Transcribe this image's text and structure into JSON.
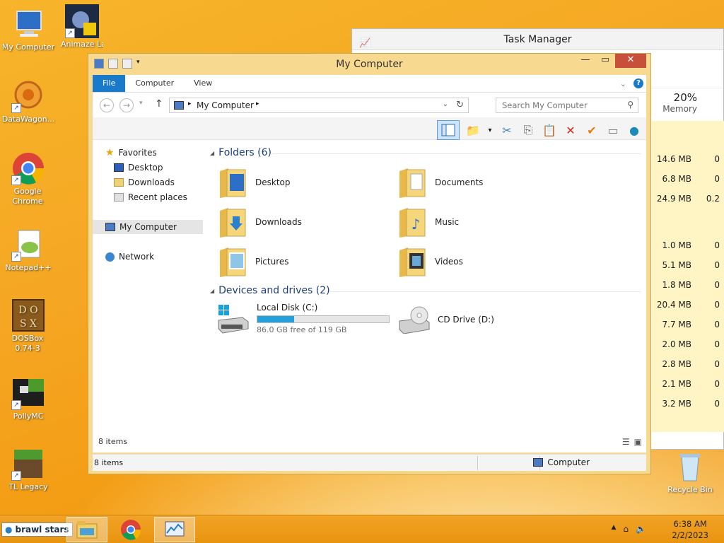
{
  "desktop": {
    "icons": [
      {
        "label": "My Computer"
      },
      {
        "label": "Animaze Launc"
      },
      {
        "label": "DataWagon..."
      },
      {
        "label": "Google Chrome"
      },
      {
        "label": "Notepad++"
      },
      {
        "label": "DOSBox 0.74-3"
      },
      {
        "label": "PollyMC"
      },
      {
        "label": "TL Legacy"
      },
      {
        "label": "Recycle Bin"
      }
    ]
  },
  "task_manager": {
    "title": "Task Manager",
    "memory_percent": "20%",
    "memory_label": "Memory",
    "rows": [
      {
        "mem": "14.6 MB",
        "cpu": "0"
      },
      {
        "mem": "6.8 MB",
        "cpu": "0"
      },
      {
        "mem": "24.9 MB",
        "cpu": "0.2"
      },
      {
        "mem": "1.0 MB",
        "cpu": "0"
      },
      {
        "mem": "5.1 MB",
        "cpu": "0"
      },
      {
        "mem": "1.8 MB",
        "cpu": "0"
      },
      {
        "mem": "20.4 MB",
        "cpu": "0"
      },
      {
        "mem": "7.7 MB",
        "cpu": "0"
      },
      {
        "mem": "2.0 MB",
        "cpu": "0"
      },
      {
        "mem": "2.8 MB",
        "cpu": "0"
      },
      {
        "mem": "2.1 MB",
        "cpu": "0"
      },
      {
        "mem": "3.2 MB",
        "cpu": "0"
      }
    ]
  },
  "explorer": {
    "title": "My Computer",
    "tabs": {
      "file": "File",
      "computer": "Computer",
      "view": "View"
    },
    "address": "My Computer",
    "search_placeholder": "Search My Computer",
    "nav": {
      "favorites": "Favorites",
      "desktop": "Desktop",
      "downloads": "Downloads",
      "recent": "Recent places",
      "my_computer": "My Computer",
      "network": "Network"
    },
    "folders_header": "Folders (6)",
    "folders": [
      {
        "label": "Desktop"
      },
      {
        "label": "Documents"
      },
      {
        "label": "Downloads"
      },
      {
        "label": "Music"
      },
      {
        "label": "Pictures"
      },
      {
        "label": "Videos"
      }
    ],
    "devices_header": "Devices and drives (2)",
    "drives": {
      "c_label": "Local Disk (C:)",
      "c_free": "86.0 GB free of 119 GB",
      "c_used_fraction": 0.277,
      "d_label": "CD Drive (D:)"
    },
    "inner_count": "8 items",
    "status_count": "8 items",
    "status_location": "Computer"
  },
  "taskbar": {
    "search_text": "brawl stars",
    "clock_time": "6:38 AM",
    "clock_date": "2/2/2023"
  }
}
